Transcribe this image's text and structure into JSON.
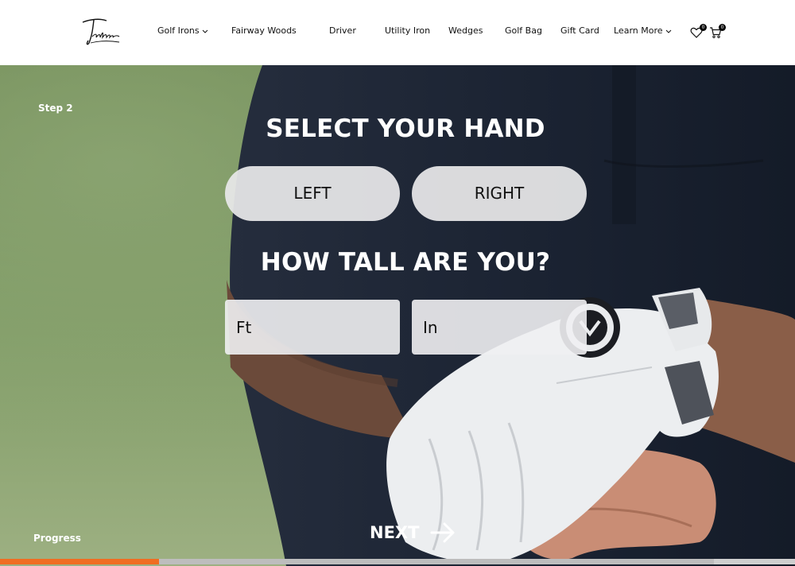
{
  "header": {
    "logo_text": "Takomo",
    "nav": [
      {
        "label": "Golf Irons",
        "has_dropdown": true
      },
      {
        "label": "Fairway Woods",
        "has_dropdown": false
      },
      {
        "label": "Driver",
        "has_dropdown": false
      },
      {
        "label": "Utility Iron",
        "has_dropdown": false
      },
      {
        "label": "Wedges",
        "has_dropdown": false
      },
      {
        "label": "Golf Bag",
        "has_dropdown": false
      },
      {
        "label": "Gift Card",
        "has_dropdown": false
      },
      {
        "label": "Learn More",
        "has_dropdown": true
      }
    ],
    "wishlist": {
      "icon": "heart-icon",
      "count": "0"
    },
    "cart": {
      "icon": "cart-icon",
      "count": "0"
    }
  },
  "quiz": {
    "step_label": "Step 2",
    "hand_title": "SELECT YOUR HAND",
    "hand_options": [
      "LEFT",
      "RIGHT"
    ],
    "height_title": "HOW TALL ARE YOU?",
    "feet_placeholder": "Ft",
    "inches_placeholder": "In",
    "next_label": "NEXT",
    "progress_label": "Progress",
    "progress_fraction": 0.2
  },
  "colors": {
    "accent": "#f06d22",
    "shirt": "#1c2433",
    "grass": "#7e9a63"
  }
}
